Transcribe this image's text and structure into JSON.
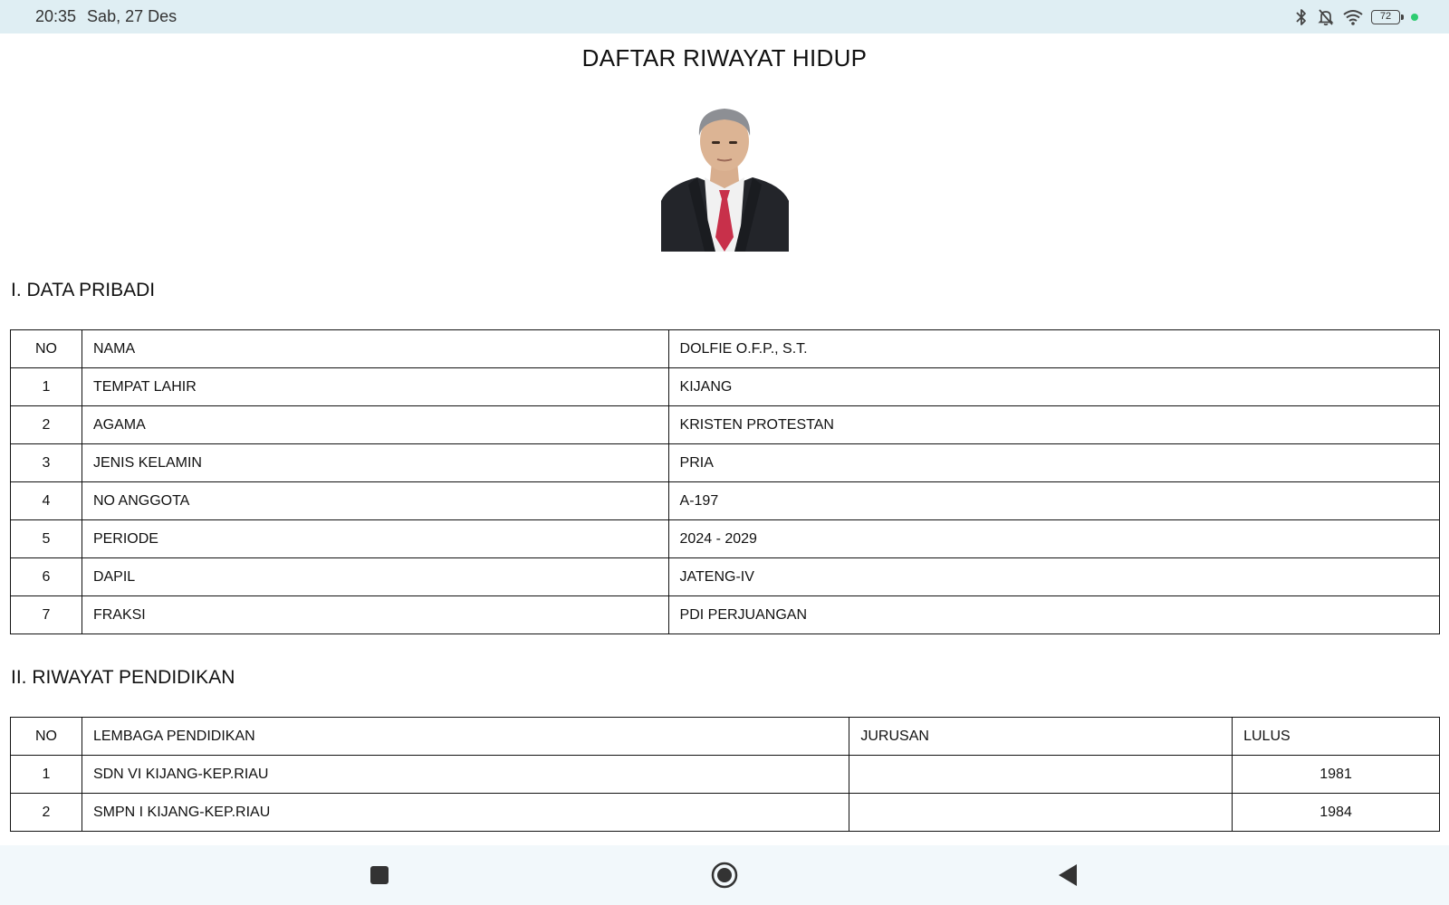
{
  "status_bar": {
    "time": "20:35",
    "date": "Sab, 27 Des",
    "battery_level": "72",
    "icons": [
      "bluetooth-icon",
      "bell-off-icon",
      "wifi-icon",
      "battery-icon",
      "indicator-dot-icon"
    ],
    "indicator_color": "#2ecc71"
  },
  "document": {
    "title": "DAFTAR RIWAYAT HIDUP",
    "section1": {
      "heading": "I. DATA PRIBADI",
      "header": {
        "no": "NO",
        "field": "NAMA",
        "value": "DOLFIE O.F.P., S.T."
      },
      "rows": [
        {
          "no": "1",
          "field": "TEMPAT LAHIR",
          "value": "KIJANG"
        },
        {
          "no": "2",
          "field": "AGAMA",
          "value": "KRISTEN PROTESTAN"
        },
        {
          "no": "3",
          "field": "JENIS KELAMIN",
          "value": "PRIA"
        },
        {
          "no": "4",
          "field": "NO ANGGOTA",
          "value": "A-197"
        },
        {
          "no": "5",
          "field": "PERIODE",
          "value": "2024 - 2029"
        },
        {
          "no": "6",
          "field": "DAPIL",
          "value": "JATENG-IV"
        },
        {
          "no": "7",
          "field": "FRAKSI",
          "value": "PDI PERJUANGAN"
        }
      ]
    },
    "section2": {
      "heading": "II. RIWAYAT PENDIDIKAN",
      "header": {
        "no": "NO",
        "institution": "LEMBAGA PENDIDIKAN",
        "major": "JURUSAN",
        "year": "LULUS"
      },
      "rows": [
        {
          "no": "1",
          "institution": "SDN VI KIJANG-KEP.RIAU",
          "major": "",
          "year": "1981"
        },
        {
          "no": "2",
          "institution": "SMPN I KIJANG-KEP.RIAU",
          "major": "",
          "year": "1984"
        }
      ]
    }
  },
  "nav_bar": {
    "icons": [
      "recents-square-icon",
      "home-circle-icon",
      "back-triangle-icon"
    ]
  }
}
